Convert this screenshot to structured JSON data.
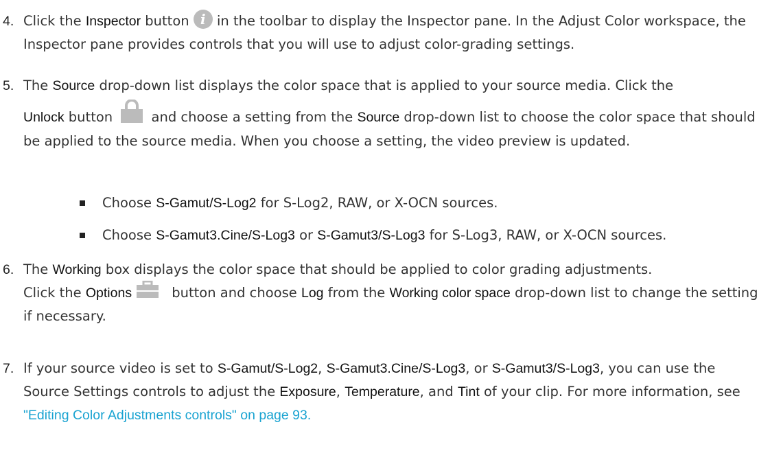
{
  "steps": [
    {
      "num": "4.",
      "parts": {
        "a": "Click the ",
        "b": "Inspector",
        "c": " button ",
        "d": " in the toolbar to display the Inspector pane. In the Adjust Color workspace, the Inspector pane provides controls that you will use to adjust color-grading settings."
      }
    },
    {
      "num": "5.",
      "parts": {
        "a": "The ",
        "b": "Source",
        "c": " drop-down list displays the color space that is applied to your source media. Click the",
        "d": "Unlock",
        "e": " button ",
        "f": " and choose a setting from the ",
        "g": "Source",
        "h": " drop-down list to choose the color space that should be applied to the source media. When you choose a setting, the video preview is updated."
      },
      "bullets": [
        {
          "a": "Choose ",
          "b": "S-Gamut/S-Log2",
          "c": " for S-Log2, RAW, or X-OCN sources."
        },
        {
          "a": "Choose ",
          "b": "S-Gamut3.Cine/S-Log3",
          "c": " or ",
          "d": "S-Gamut3/S-Log3",
          "e": " for S-Log3, RAW, or X-OCN sources."
        }
      ]
    },
    {
      "num": "6.",
      "parts": {
        "a": "The ",
        "b": "Working",
        "c": " box displays the color space that should be applied to color grading adjustments.",
        "d": "Click the ",
        "e": "Options",
        "f": " button and choose ",
        "g": "Log",
        "h": " from the ",
        "i": "Working color space",
        "j": " drop-down list to change the setting if necessary."
      }
    },
    {
      "num": "7.",
      "parts": {
        "a": "If your source video is set to ",
        "b": "S-Gamut/S-Log2",
        "c": ", ",
        "d": "S-Gamut3.Cine/S-Log3",
        "e": ", or ",
        "f": "S-Gamut3/S-Log3",
        "g": ", you can use the Source Settings controls to adjust the ",
        "h": "Exposure",
        "i": ", ",
        "j": "Temperature",
        "k": ", and ",
        "l": "Tint",
        "m": " of your clip. For more information, see ",
        "link": "\"Editing Color Adjustments controls\" on page 93."
      }
    }
  ],
  "icons": {
    "inspector": "info-icon",
    "unlock": "lock-icon",
    "options": "toolbox-icon",
    "icon_color": "#bbbbbb",
    "link_color": "#19a3d1"
  }
}
